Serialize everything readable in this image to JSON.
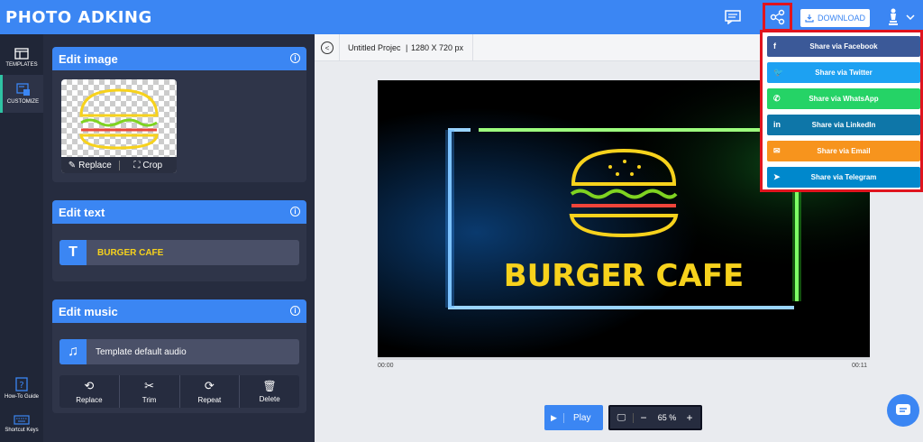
{
  "app": {
    "logo": "PHOTO ADKING",
    "download_label": "DOWNLOAD"
  },
  "sidebar": {
    "items": [
      {
        "label": "TEMPLATES",
        "icon": "layout-icon"
      },
      {
        "label": "CUSTOMIZE",
        "icon": "customize-icon"
      },
      {
        "label": "How-To Guide",
        "icon": "question-icon"
      },
      {
        "label": "Shortcut Keys",
        "icon": "keyboard-icon"
      }
    ]
  },
  "panel": {
    "edit_image": {
      "title": "Edit image",
      "replace": "Replace",
      "crop": "Crop"
    },
    "edit_text": {
      "title": "Edit text",
      "value": "BURGER CAFE",
      "icon_glyph": "T"
    },
    "edit_music": {
      "title": "Edit music",
      "track": "Template default audio",
      "actions": [
        "Replace",
        "Trim",
        "Repeat",
        "Delete"
      ]
    }
  },
  "workspace": {
    "project_name": "Untitled Projec",
    "resolution": "1280 X 720 px",
    "canvas_text": "BURGER CAFE",
    "time_start": "00:00",
    "time_end": "00:11",
    "play_label": "Play",
    "zoom_level": "65 %"
  },
  "share_menu": {
    "items": [
      {
        "label": "Share via Facebook",
        "color": "#3b5998",
        "glyph": "f"
      },
      {
        "label": "Share via Twitter",
        "color": "#1da1f2",
        "glyph": "🐦"
      },
      {
        "label": "Share via WhatsApp",
        "color": "#25d366",
        "glyph": "✆"
      },
      {
        "label": "Share via LinkedIn",
        "color": "#0e76a8",
        "glyph": "in"
      },
      {
        "label": "Share via Email",
        "color": "#f7941d",
        "glyph": "✉"
      },
      {
        "label": "Share via Telegram",
        "color": "#0088cc",
        "glyph": "➤"
      }
    ]
  },
  "colors": {
    "accent": "#3b86f3",
    "panel": "#262c3f",
    "highlight": "#e0141e",
    "neon_yellow": "#f7d21c"
  }
}
